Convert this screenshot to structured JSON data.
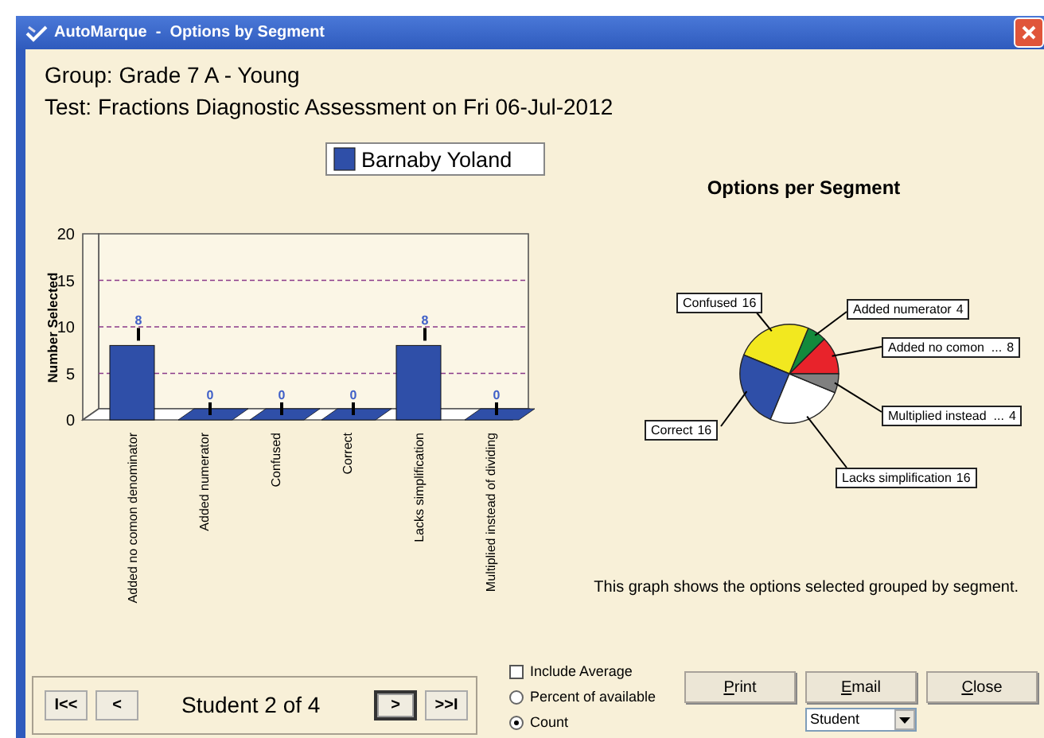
{
  "window": {
    "title": "AutoMarque  -  Options by Segment"
  },
  "header": {
    "group": "Group: Grade 7 A - Young",
    "test": "Test: Fractions Diagnostic Assessment on Fri 06-Jul-2012"
  },
  "bar_chart": {
    "chart_data": {
      "type": "bar",
      "ylabel": "Number Selected",
      "categories": [
        "Added no comon denominator",
        "Added numerator",
        "Confused",
        "Correct",
        "Lacks simplification",
        "Multiplied instead of dividing"
      ],
      "series": [
        {
          "name": "Barnaby Yoland",
          "color": "#2f4fa8",
          "values": [
            8,
            0,
            0,
            0,
            8,
            0
          ]
        }
      ],
      "yticks": [
        0,
        5,
        10,
        15,
        20
      ],
      "ylim": [
        0,
        20
      ],
      "grid": true,
      "data_labels": true
    }
  },
  "pie_chart": {
    "chart_data": {
      "type": "pie",
      "title": "Options per Segment",
      "categories": [
        "Added no comon  ...",
        "Added numerator",
        "Confused",
        "Correct",
        "Lacks simplification",
        "Multiplied instead  ..."
      ],
      "series": [
        {
          "values": [
            8,
            4,
            16,
            16,
            16,
            4
          ]
        }
      ],
      "colors": [
        "#e8232b",
        "#138a3c",
        "#f2e81f",
        "#2f4fa8",
        "#ffffff",
        "#808080"
      ],
      "data_labels": true
    },
    "caption": "This graph shows the options selected grouped by segment."
  },
  "navigator": {
    "buttons": [
      {
        "label": "I<<",
        "focused": false
      },
      {
        "label": "<",
        "focused": false
      },
      {
        "label": ">",
        "focused": true
      },
      {
        "label": ">>I",
        "focused": false
      }
    ],
    "status": "Student 2 of 4"
  },
  "options": [
    {
      "kind": "checkbox",
      "label": "Include Average",
      "checked": false
    },
    {
      "kind": "radio",
      "label": "Percent of available",
      "selected": false
    },
    {
      "kind": "radio",
      "label": "Count",
      "selected": true
    }
  ],
  "buttons": [
    "Print",
    "Email",
    "Close"
  ],
  "dropdown": {
    "value": "Student"
  }
}
